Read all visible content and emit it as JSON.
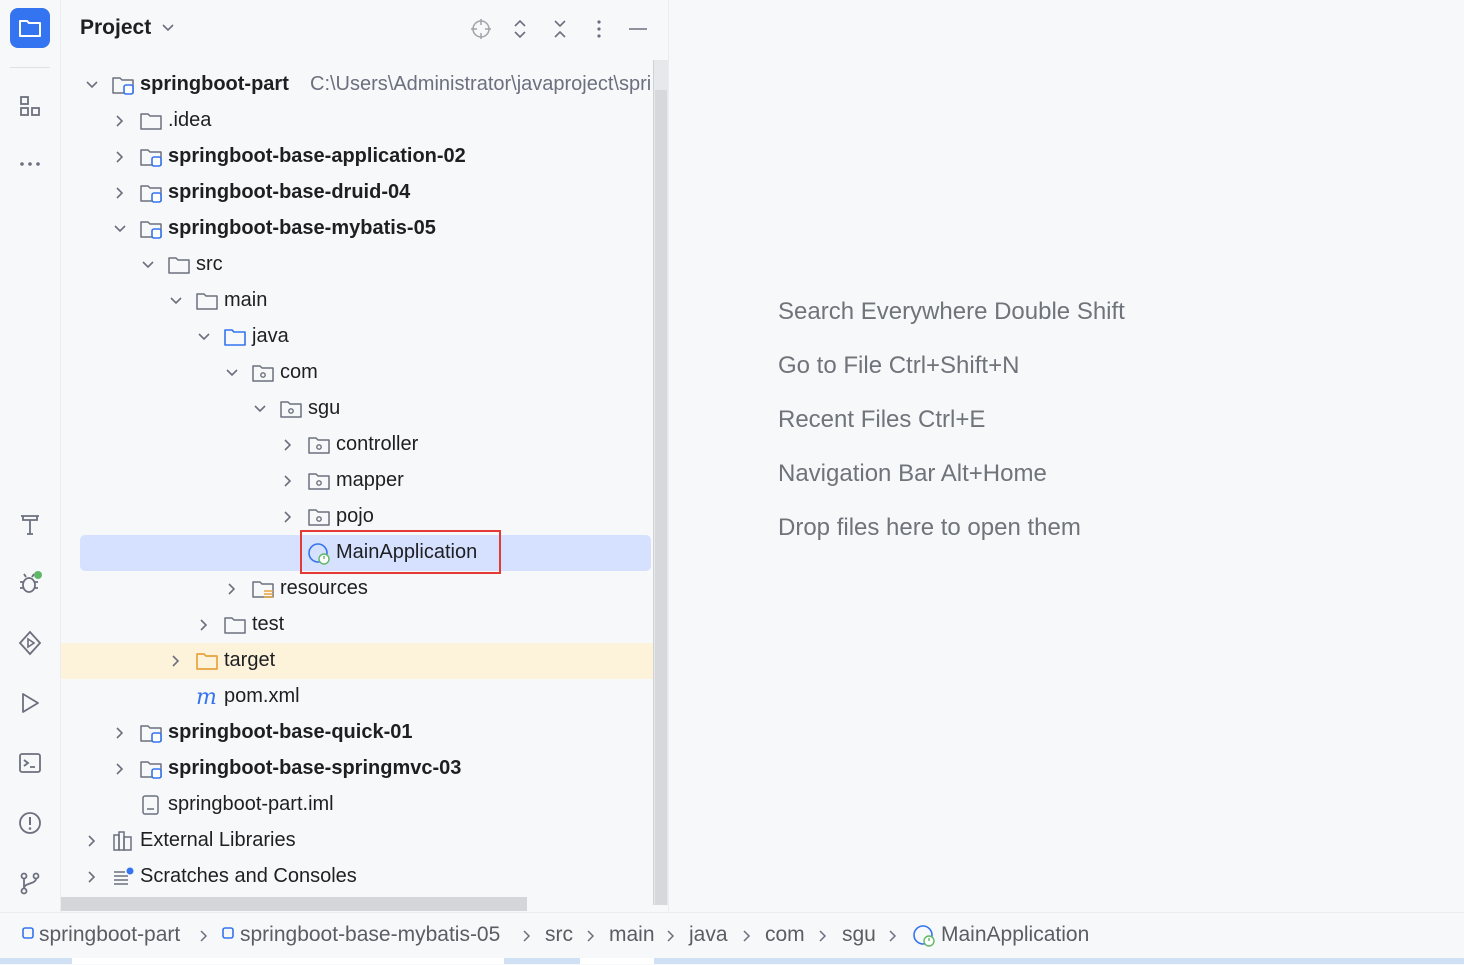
{
  "toolstrip": {
    "items": [
      {
        "name": "project-icon",
        "active": true
      },
      {
        "name": "structure-icon"
      },
      {
        "name": "more-icon"
      },
      {
        "name": "build-hammer-icon"
      },
      {
        "name": "debug-icon"
      },
      {
        "name": "services-icon"
      },
      {
        "name": "run-icon"
      },
      {
        "name": "terminal-icon"
      },
      {
        "name": "problems-icon"
      },
      {
        "name": "git-icon"
      }
    ]
  },
  "panel": {
    "title": "Project",
    "header_buttons": [
      "locate-icon",
      "expand-collapse-icon",
      "collapse-all-icon",
      "options-kebab-icon",
      "minimize-icon"
    ]
  },
  "tree": [
    {
      "label": "springboot-part",
      "path": "C:\\Users\\Administrator\\javaproject\\spri",
      "icon": "module-folder-icon",
      "bold": true,
      "depth": 0,
      "expanded": true
    },
    {
      "label": ".idea",
      "icon": "folder-icon",
      "bold": false,
      "depth": 1,
      "expanded": false
    },
    {
      "label": "springboot-base-application-02",
      "icon": "module-folder-icon",
      "bold": true,
      "depth": 1,
      "expanded": false
    },
    {
      "label": "springboot-base-druid-04",
      "icon": "module-folder-icon",
      "bold": true,
      "depth": 1,
      "expanded": false
    },
    {
      "label": "springboot-base-mybatis-05",
      "icon": "module-folder-icon",
      "bold": true,
      "depth": 1,
      "expanded": true
    },
    {
      "label": "src",
      "icon": "folder-icon",
      "bold": false,
      "depth": 2,
      "expanded": true
    },
    {
      "label": "main",
      "icon": "folder-icon",
      "bold": false,
      "depth": 3,
      "expanded": true
    },
    {
      "label": "java",
      "icon": "source-folder-icon",
      "bold": false,
      "depth": 4,
      "expanded": true
    },
    {
      "label": "com",
      "icon": "package-icon",
      "bold": false,
      "depth": 5,
      "expanded": true
    },
    {
      "label": "sgu",
      "icon": "package-icon",
      "bold": false,
      "depth": 6,
      "expanded": true
    },
    {
      "label": "controller",
      "icon": "package-icon",
      "bold": false,
      "depth": 7,
      "expanded": false
    },
    {
      "label": "mapper",
      "icon": "package-icon",
      "bold": false,
      "depth": 7,
      "expanded": false
    },
    {
      "label": "pojo",
      "icon": "package-icon",
      "bold": false,
      "depth": 7,
      "expanded": false
    },
    {
      "label": "MainApplication",
      "icon": "spring-boot-class-icon",
      "bold": false,
      "depth": 7,
      "leaf": true,
      "selected": true
    },
    {
      "label": "resources",
      "icon": "resources-folder-icon",
      "bold": false,
      "depth": 5,
      "expanded": false
    },
    {
      "label": "test",
      "icon": "folder-icon",
      "bold": false,
      "depth": 4,
      "expanded": false
    },
    {
      "label": "target",
      "icon": "excluded-folder-icon",
      "bold": false,
      "depth": 3,
      "expanded": false,
      "excluded": true
    },
    {
      "label": "pom.xml",
      "icon": "maven-icon",
      "bold": false,
      "depth": 3,
      "leaf": true
    },
    {
      "label": "springboot-base-quick-01",
      "icon": "module-folder-icon",
      "bold": true,
      "depth": 1,
      "expanded": false
    },
    {
      "label": "springboot-base-springmvc-03",
      "icon": "module-folder-icon",
      "bold": true,
      "depth": 1,
      "expanded": false
    },
    {
      "label": "springboot-part.iml",
      "icon": "iml-file-icon",
      "bold": false,
      "depth": 1,
      "leaf": true
    },
    {
      "label": "External Libraries",
      "icon": "libraries-icon",
      "bold": false,
      "depth": 0,
      "expanded": false
    },
    {
      "label": "Scratches and Consoles",
      "icon": "scratches-icon",
      "bold": false,
      "depth": 0,
      "expanded": false
    }
  ],
  "editor": {
    "hints": [
      "Search Everywhere Double Shift",
      "Go to File Ctrl+Shift+N",
      "Recent Files Ctrl+E",
      "Navigation Bar Alt+Home",
      "Drop files here to open them"
    ]
  },
  "breadcrumbs": [
    {
      "label": "springboot-part",
      "icon": "module-icon"
    },
    {
      "label": "springboot-base-mybatis-05",
      "icon": "module-icon"
    },
    {
      "label": "src"
    },
    {
      "label": "main"
    },
    {
      "label": "java"
    },
    {
      "label": "com"
    },
    {
      "label": "sgu"
    },
    {
      "label": "MainApplication",
      "icon": "spring-boot-class-icon"
    }
  ],
  "colors": {
    "accent": "#3574f0",
    "selection": "#d5e1ff",
    "excluded_row": "#fdf3da",
    "highlight_box": "#e53935",
    "excluded_folder": "#e8a33d"
  }
}
